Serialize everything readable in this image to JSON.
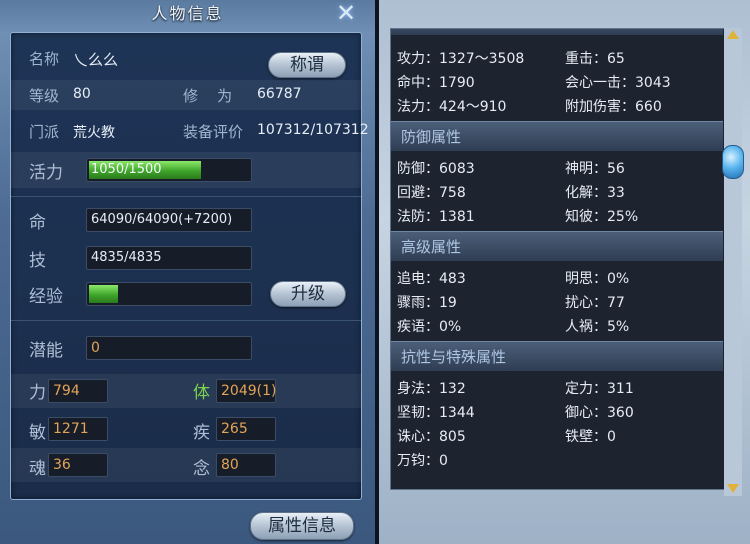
{
  "left": {
    "title": "人物信息",
    "name_label": "名称",
    "name_value": "乀么么",
    "title_button": "称谓",
    "level_label": "等级",
    "level_value": "80",
    "cultivation_label": "修    为",
    "cultivation_value": "66787",
    "sect_label": "门派",
    "sect_value": "荒火教",
    "equip_label": "装备评价",
    "equip_value": "107312/107312",
    "vitality_label": "活力",
    "vitality_text": "1050/1500",
    "vitality_fraction": 0.7,
    "hp_label": "命",
    "hp_value": "64090/64090(+7200)",
    "skill_label": "技",
    "skill_value": "4835/4835",
    "exp_label": "经验",
    "exp_fraction": 0.18,
    "upgrade_button": "升级",
    "potential_label": "潜能",
    "potential_value": "0",
    "str_label": "力",
    "str_value": "794",
    "con_label": "体",
    "con_value": "2049(1)",
    "agi_label": "敏",
    "agi_value": "1271",
    "spd_label": "疾",
    "spd_value": "265",
    "soul_label": "魂",
    "soul_value": "36",
    "mind_label": "念",
    "mind_value": "80",
    "attr_button": "属性信息"
  },
  "right": {
    "attack_stats": [
      {
        "label": "攻力：",
        "value": "1327～3508"
      },
      {
        "label": "重击：",
        "value": "65"
      },
      {
        "label": "命中：",
        "value": "1790"
      },
      {
        "label": "会心一击：",
        "value": "3043"
      },
      {
        "label": "法力：",
        "value": "424～910"
      },
      {
        "label": "附加伤害：",
        "value": "660"
      }
    ],
    "defense_header": "防御属性",
    "defense_stats": [
      {
        "label": "防御：",
        "value": "6083"
      },
      {
        "label": "神明：",
        "value": "56"
      },
      {
        "label": "回避：",
        "value": "758"
      },
      {
        "label": "化解：",
        "value": "33"
      },
      {
        "label": "法防：",
        "value": "1381"
      },
      {
        "label": "知彼：",
        "value": "25%"
      }
    ],
    "advanced_header": "高级属性",
    "advanced_stats": [
      {
        "label": "追电：",
        "value": "483"
      },
      {
        "label": "明思：",
        "value": "0%"
      },
      {
        "label": "骤雨：",
        "value": "19"
      },
      {
        "label": "扰心：",
        "value": "77"
      },
      {
        "label": "疾语：",
        "value": "0%"
      },
      {
        "label": "人祸：",
        "value": "5%"
      }
    ],
    "resist_header": "抗性与特殊属性",
    "resist_stats": [
      {
        "label": "身法：",
        "value": "132"
      },
      {
        "label": "定力：",
        "value": "311"
      },
      {
        "label": "坚韧：",
        "value": "1344"
      },
      {
        "label": "御心：",
        "value": "360"
      },
      {
        "label": "诛心：",
        "value": "805"
      },
      {
        "label": "铁壁：",
        "value": "0"
      },
      {
        "label": "万钧：",
        "value": "0"
      }
    ]
  },
  "colors": {
    "orange_value": "#e3a457",
    "green_label": "#7bd24e",
    "bar_green": "#3fa62b",
    "scroll_arrow": "#e0b23a"
  },
  "icons": {
    "close": "close-icon",
    "scroll_up": "scroll-up-arrow-icon",
    "scroll_down": "scroll-down-arrow-icon"
  }
}
